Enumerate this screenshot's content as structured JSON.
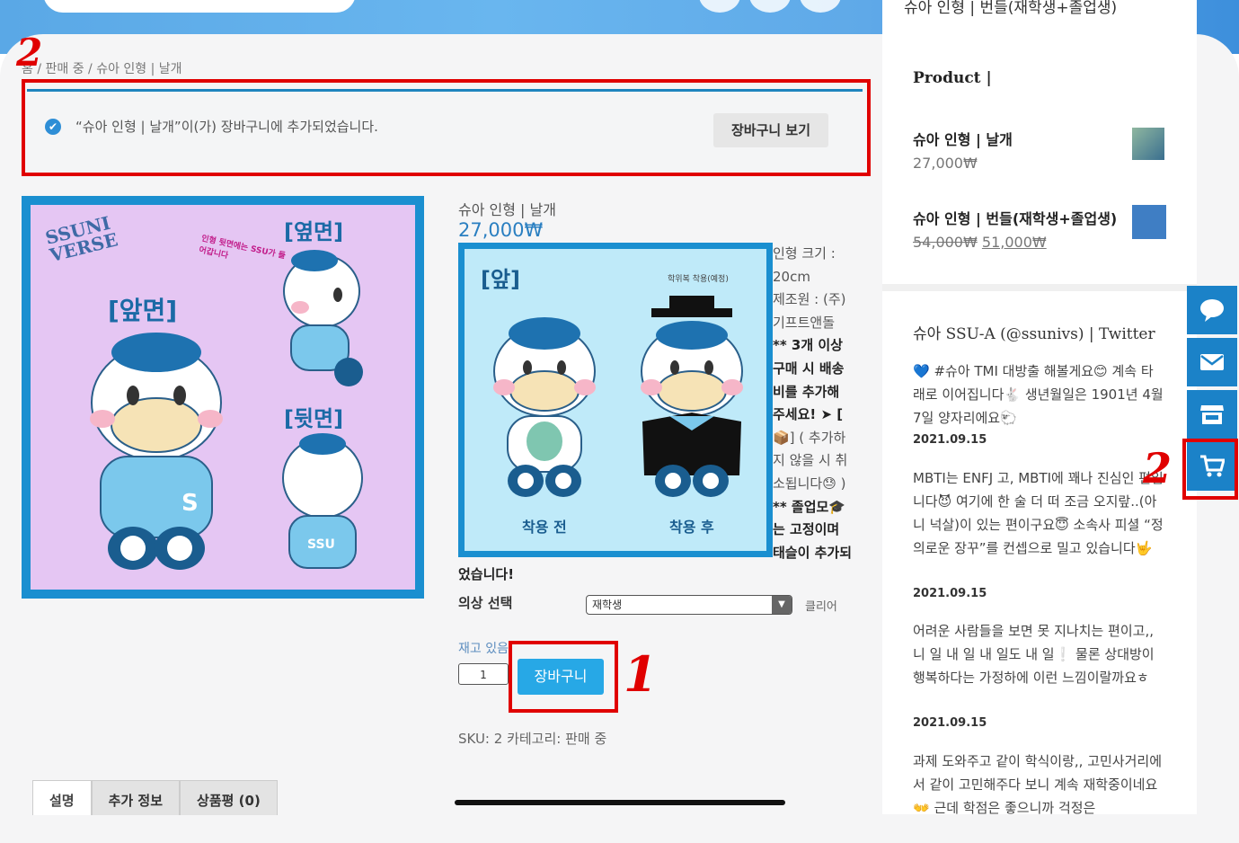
{
  "header": {
    "partial_title": "슈아 인형 | 번들(재학생+졸업생)"
  },
  "breadcrumb": "홈 / 판매 중 / 슈아 인형 | 날개",
  "notice": {
    "message": "“슈아 인형 | 날개”이(가) 장바구니에 추가되었습니다.",
    "view_cart": "장바구니 보기"
  },
  "annotations": {
    "num1": "1",
    "num2a": "2",
    "num2b": "2"
  },
  "product_image": {
    "logo": "SSUNI VERSE",
    "front": "[앞면]",
    "side": "[옆면]",
    "back": "[뒷면]",
    "note": "인형 뒷면에는 SSU가 들어갑니다",
    "back_text": "SSU"
  },
  "mini_image": {
    "front": "[앞]",
    "before": "착용 전",
    "after": "착용 후",
    "note": "학위복 착용(예정)"
  },
  "product": {
    "title": "슈아 인형 | 날개",
    "price": "27,000₩",
    "desc_lines": [
      "인형 크기 :",
      "20cm",
      "제조원 : (주)",
      "기프트앤돌",
      "** 3개 이상",
      "구매 시 배송",
      "비를 추가해",
      "주세요! ➤ [",
      "📦] ( 추가하",
      "지 않을 시 취",
      "소됩니다😓 )",
      "** 졸업모🎓",
      "는 고정이며",
      "태슬이 추가되"
    ],
    "desc_tail": "었습니다!",
    "option_label": "의상 선택",
    "option_value": "재학생",
    "option_clear": "클리어",
    "stock": "재고 있음",
    "qty": "1",
    "add_to_cart": "장바구니",
    "sku": "SKU: 2 카테고리: 판매 중"
  },
  "tabs": [
    "설명",
    "추가 정보",
    "상품평 (0)"
  ],
  "sidebar": {
    "section_title": "Product |",
    "products": [
      {
        "name": "슈아 인형 | 날개",
        "price": "27,000₩",
        "old_price": ""
      },
      {
        "name": "슈아 인형 | 번들(재학생+졸업생)",
        "price": "51,000₩",
        "old_price": "54,000₩"
      }
    ],
    "twitter_title": "슈아 SSU-A (@ssunivs) | Twitter",
    "tweets": [
      {
        "text": "💙 #슈아 TMI 대방출 해볼게요😊 계속 타래로 이어집니다🐇 생년월일은 1901년 4월 7일 양자리에요🐑",
        "date": "2021.09.15"
      },
      {
        "text": "MBTI는 ENFJ 고, MBTI에 꽤나 진심인 편입니다😈 여기에 한 술 더 떠 조금 오지랖..(아니 넉살)이 있는 편이구요😇 소속사 피셜 “정의로운 장꾸”를 컨셉으로 밀고 있습니다🤟",
        "date": "2021.09.15"
      },
      {
        "text": "어려운 사람들을 보면 못 지나치는 편이고,, 니 일 내 일 내 일도 내 일❕ 물론 상대방이 행복하다는 가정하에 이런 느낌이랄까요ㅎ",
        "date": "2021.09.15"
      },
      {
        "text": "과제 도와주고 같이 학식이랑,, 고민사거리에서 같이 고민해주다 보니 계속 재학중이네요👐 근데 학점은 좋으니까 걱정은",
        "date": ""
      }
    ]
  },
  "side_buttons": [
    "chat-icon",
    "mail-icon",
    "store-icon",
    "cart-icon"
  ],
  "colors": {
    "accent": "#1b82c8",
    "annotation": "#e00000",
    "button": "#27a8e6"
  }
}
